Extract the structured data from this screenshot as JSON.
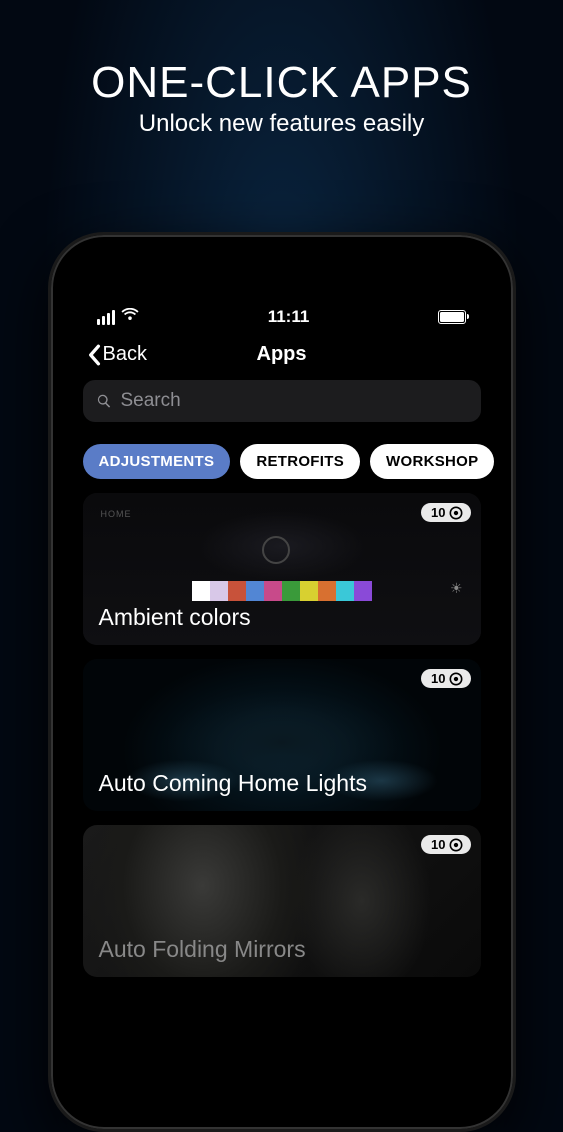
{
  "promo": {
    "title": "ONE-CLICK APPS",
    "subtitle": "Unlock new features easily"
  },
  "statusBar": {
    "time": "11:11"
  },
  "nav": {
    "back": "Back",
    "title": "Apps"
  },
  "search": {
    "placeholder": "Search"
  },
  "tabs": [
    {
      "label": "ADJUSTMENTS",
      "active": true
    },
    {
      "label": "RETROFITS",
      "active": false
    },
    {
      "label": "WORKSHOP",
      "active": false
    }
  ],
  "cards": [
    {
      "title": "Ambient colors",
      "badge": "10"
    },
    {
      "title": "Auto Coming Home Lights",
      "badge": "10"
    },
    {
      "title": "Auto Folding Mirrors",
      "badge": "10"
    }
  ],
  "ambientColors": [
    "#fff",
    "#d8c8e8",
    "#c8523a",
    "#5286d4",
    "#c84a8a",
    "#3a9a3a",
    "#d8d030",
    "#d87030",
    "#3ac8d8",
    "#8a4ad8"
  ]
}
